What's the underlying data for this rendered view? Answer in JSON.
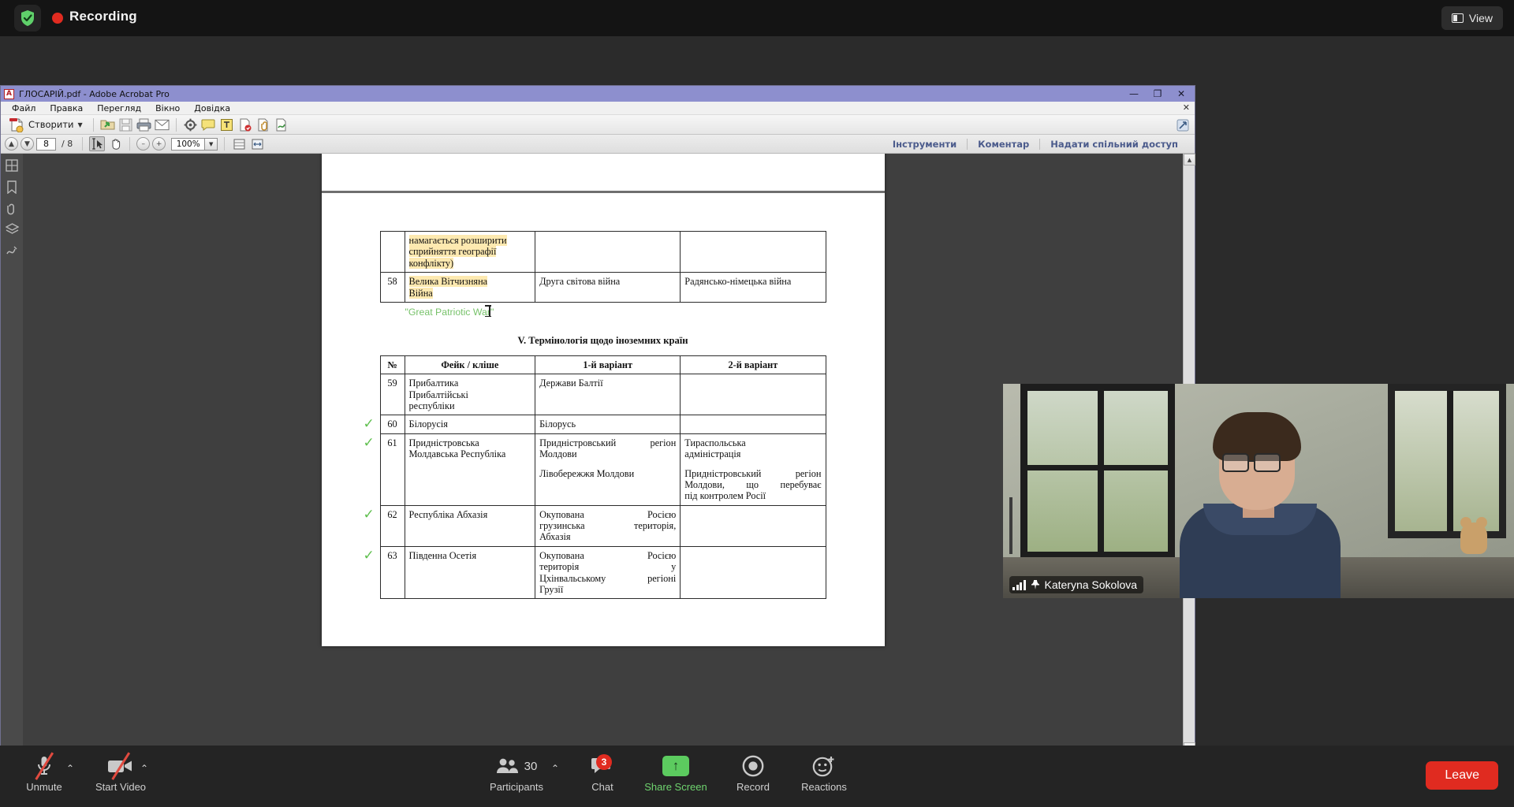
{
  "zoom_app": {
    "topbar": {
      "shield_icon": "shield-check-icon",
      "recording_label": "Recording",
      "view_button": "View"
    },
    "video_tile": {
      "participant_name": "Kateryna Sokolova",
      "signal_icon": "signal-bars-icon",
      "pin_icon": "pin-icon"
    },
    "bottombar": {
      "controls": [
        {
          "name": "unmute",
          "label": "Unmute",
          "icon": "microphone-muted-icon",
          "has_caret": true
        },
        {
          "name": "start-video",
          "label": "Start Video",
          "icon": "video-camera-off-icon",
          "has_caret": true
        },
        {
          "name": "participants",
          "label": "Participants",
          "icon": "people-icon",
          "count": "30",
          "has_caret": true
        },
        {
          "name": "chat",
          "label": "Chat",
          "icon": "chat-bubble-icon",
          "badge": "3"
        },
        {
          "name": "share-screen",
          "label": "Share Screen",
          "icon": "up-arrow-icon"
        },
        {
          "name": "record",
          "label": "Record",
          "icon": "record-circle-icon"
        },
        {
          "name": "reactions",
          "label": "Reactions",
          "icon": "smiley-plus-icon"
        }
      ],
      "leave_button": "Leave"
    }
  },
  "acrobat": {
    "titlebar": {
      "logo_text": "A",
      "title": "ГЛОСАРІЙ.pdf - Adobe Acrobat Pro",
      "minimize": "—",
      "restore": "❐",
      "close": "✕"
    },
    "menu": {
      "items": [
        "Файл",
        "Правка",
        "Перегляд",
        "Вікно",
        "Довідка"
      ],
      "close_doc": "✕"
    },
    "toolbar": {
      "create_label": "Створити",
      "create_caret": "▼",
      "icons": [
        "create-pdf-icon",
        "open-folder-icon",
        "save-icon",
        "print-icon",
        "email-icon",
        "settings-gear-icon",
        "sticky-note-icon",
        "highlight-text-icon",
        "stamp-icon",
        "attach-file-icon",
        "sign-icon"
      ],
      "right_icon": "expand-tools-icon"
    },
    "navbar": {
      "prev_page_icon": "arrow-up-icon",
      "next_page_icon": "arrow-down-icon",
      "page_number": "8",
      "page_total": "/ 8",
      "select_tool_icon": "select-text-icon",
      "hand_tool_icon": "hand-icon",
      "zoom_out_icon": "minus-circle-icon",
      "zoom_in_icon": "plus-circle-icon",
      "zoom_value": "100%",
      "zoom_caret": "▼",
      "fit_page_icon": "fit-page-icon",
      "fit_width_icon": "fit-width-icon",
      "links": [
        "Інструменти",
        "Коментар",
        "Надати спільний доступ"
      ]
    },
    "left_rail_icons": [
      "page-thumbnails-icon",
      "bookmarks-icon",
      "attachments-icon",
      "layers-icon",
      "signatures-icon"
    ],
    "scrollbar": {
      "up": "▲",
      "down": "▼"
    }
  },
  "document": {
    "table_top": {
      "rows": [
        {
          "num": "",
          "col2_lines": [
            "намагається  розширити",
            "сприйняття        географії",
            "конфлікту)"
          ],
          "col2_highlight": true,
          "col3": "",
          "col4": ""
        },
        {
          "num": "58",
          "col2_lines": [
            "Велика         Вітчизняна",
            "Війна"
          ],
          "col2_highlight": true,
          "col3": "Друга світова війна",
          "col4": "Радянсько-німецька війна"
        }
      ]
    },
    "green_annotation": "\"Great Patriotic War\"",
    "section_heading": "V. Термінологія щодо іноземних країн",
    "table_headers": [
      "№",
      "Фейк / кліше",
      "1-й варіант",
      "2-й варіант"
    ],
    "table_rows": [
      {
        "check": false,
        "num": "59",
        "col2_lines": [
          "Прибалтика",
          "Прибалтійські",
          "республіки"
        ],
        "col3_lines": [
          "Держави Балтії"
        ],
        "col4_lines": []
      },
      {
        "check": true,
        "num": "60",
        "col2_lines": [
          "Білорусія"
        ],
        "col3_lines": [
          "Білорусь"
        ],
        "col4_lines": []
      },
      {
        "check": true,
        "num": "61",
        "col2_lines": [
          "Придністровська",
          "Молдавська Республіка"
        ],
        "col3_lines": [
          "Придністровський    регіон",
          "Молдови",
          "Лівобережжя Молдови"
        ],
        "col4_lines": [
          "Тираспольська",
          "адміністрація",
          "Придністровський    регіон",
          "Молдови,    що    перебуває",
          "під контролем Росії"
        ]
      },
      {
        "check": true,
        "num": "62",
        "col2_lines": [
          "Республіка Абхазія"
        ],
        "col3_lines": [
          "Окупована          Росією",
          "грузинська       територія,",
          "Абхазія"
        ],
        "col4_lines": []
      },
      {
        "check": true,
        "num": "63",
        "col2_lines": [
          "Південна Осетія"
        ],
        "col3_lines": [
          "Окупована          Росією",
          "територія                    у",
          "Цхінвальському      регіоні",
          "Грузії"
        ],
        "col4_lines": []
      }
    ]
  },
  "colors": {
    "recording_red": "#e02b20",
    "highlight_yellow": "#fde9b0",
    "annotation_green": "#77c26a",
    "check_green": "#5fbf4e",
    "acrobat_title_purple": "#8d8fce",
    "link_blue": "#4b5b8c",
    "share_green": "#5ccb5f"
  }
}
